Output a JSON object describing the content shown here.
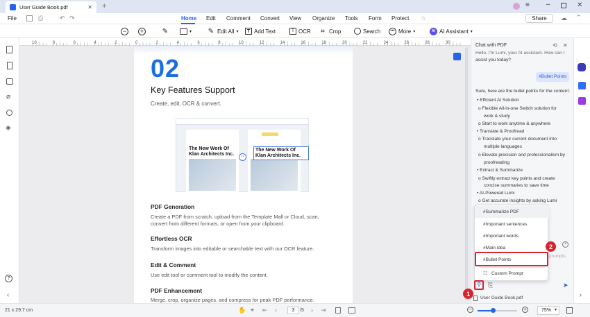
{
  "tab": {
    "title": "User Guide Book.pdf"
  },
  "menu": {
    "file": "File",
    "share": "Share",
    "tabs": [
      "Home",
      "Edit",
      "Comment",
      "Convert",
      "View",
      "Organize",
      "Tools",
      "Form",
      "Protect"
    ]
  },
  "toolbar": {
    "edit_all": "Edit All",
    "add_text": "Add Text",
    "ocr": "OCR",
    "crop": "Crop",
    "search": "Search",
    "more": "More",
    "ai": "AI Assistant"
  },
  "ruler": [
    "10",
    "8",
    "6",
    "4",
    "2",
    "0",
    "2",
    "4",
    "6",
    "8",
    "10",
    "12",
    "14",
    "16",
    "18",
    "20",
    "22",
    "24",
    "26",
    "28",
    "30"
  ],
  "doc": {
    "number": "02",
    "heading": "Key Features Support",
    "subtitle": "Create, edit, OCR & convert.",
    "image_left": "The New Work Of Klan Architects Inc.",
    "image_right": "The New Work Of Klan Architects Inc.",
    "sections": [
      {
        "title": "PDF Generation",
        "lines": [
          "Create a PDF from scratch, upload from the Template Mall or Cloud, scan,",
          "convert from different formats, or open from your clipboard."
        ]
      },
      {
        "title": "Effortless OCR",
        "lines": [
          "Transform images into editable or searchable text with our OCR feature."
        ]
      },
      {
        "title": "Edit & Comment",
        "lines": [
          "Use edit tool or comment tool to modify the content."
        ]
      },
      {
        "title": "PDF Enhancement",
        "lines": [
          "Merge, crop, organize pages, and compress for peak PDF performance."
        ]
      }
    ]
  },
  "chat": {
    "header": "Chat with PDF",
    "intro1": "Hello, I'm Lumi, your AI assistant. How can I",
    "intro2": "assist you today?",
    "user_msg": "#Bullet Points",
    "lines": [
      "Sure, here are the bullet points for the content:",
      "• Efficient AI Solution",
      "o Flexible All-in-one Switch solution for",
      "work & study",
      "o Start to work anytime & anywhere",
      "• Translate & Proofread",
      "o Translate your current document into",
      "multiple languages",
      "o Elevate precision and professionalism by",
      "proofreading",
      "• Extract & Summarize",
      "o Swiftly extract key points and create",
      "concise summaries to save time",
      "• AI-Powered Lumi",
      "o Get accurate insights by asking Lumi"
    ],
    "prompts": [
      "#Summarize PDF",
      "#Important sentences",
      "#Important words",
      "#Main idea",
      "#Bullet Points",
      "Custom Prompt"
    ],
    "hint": "prompts.",
    "file": "User Guide Book.pdf"
  },
  "badges": [
    "1",
    "2"
  ],
  "status": {
    "size": "21 x 29.7 cm",
    "page": "3",
    "total": "/5",
    "zoom": "75%"
  }
}
